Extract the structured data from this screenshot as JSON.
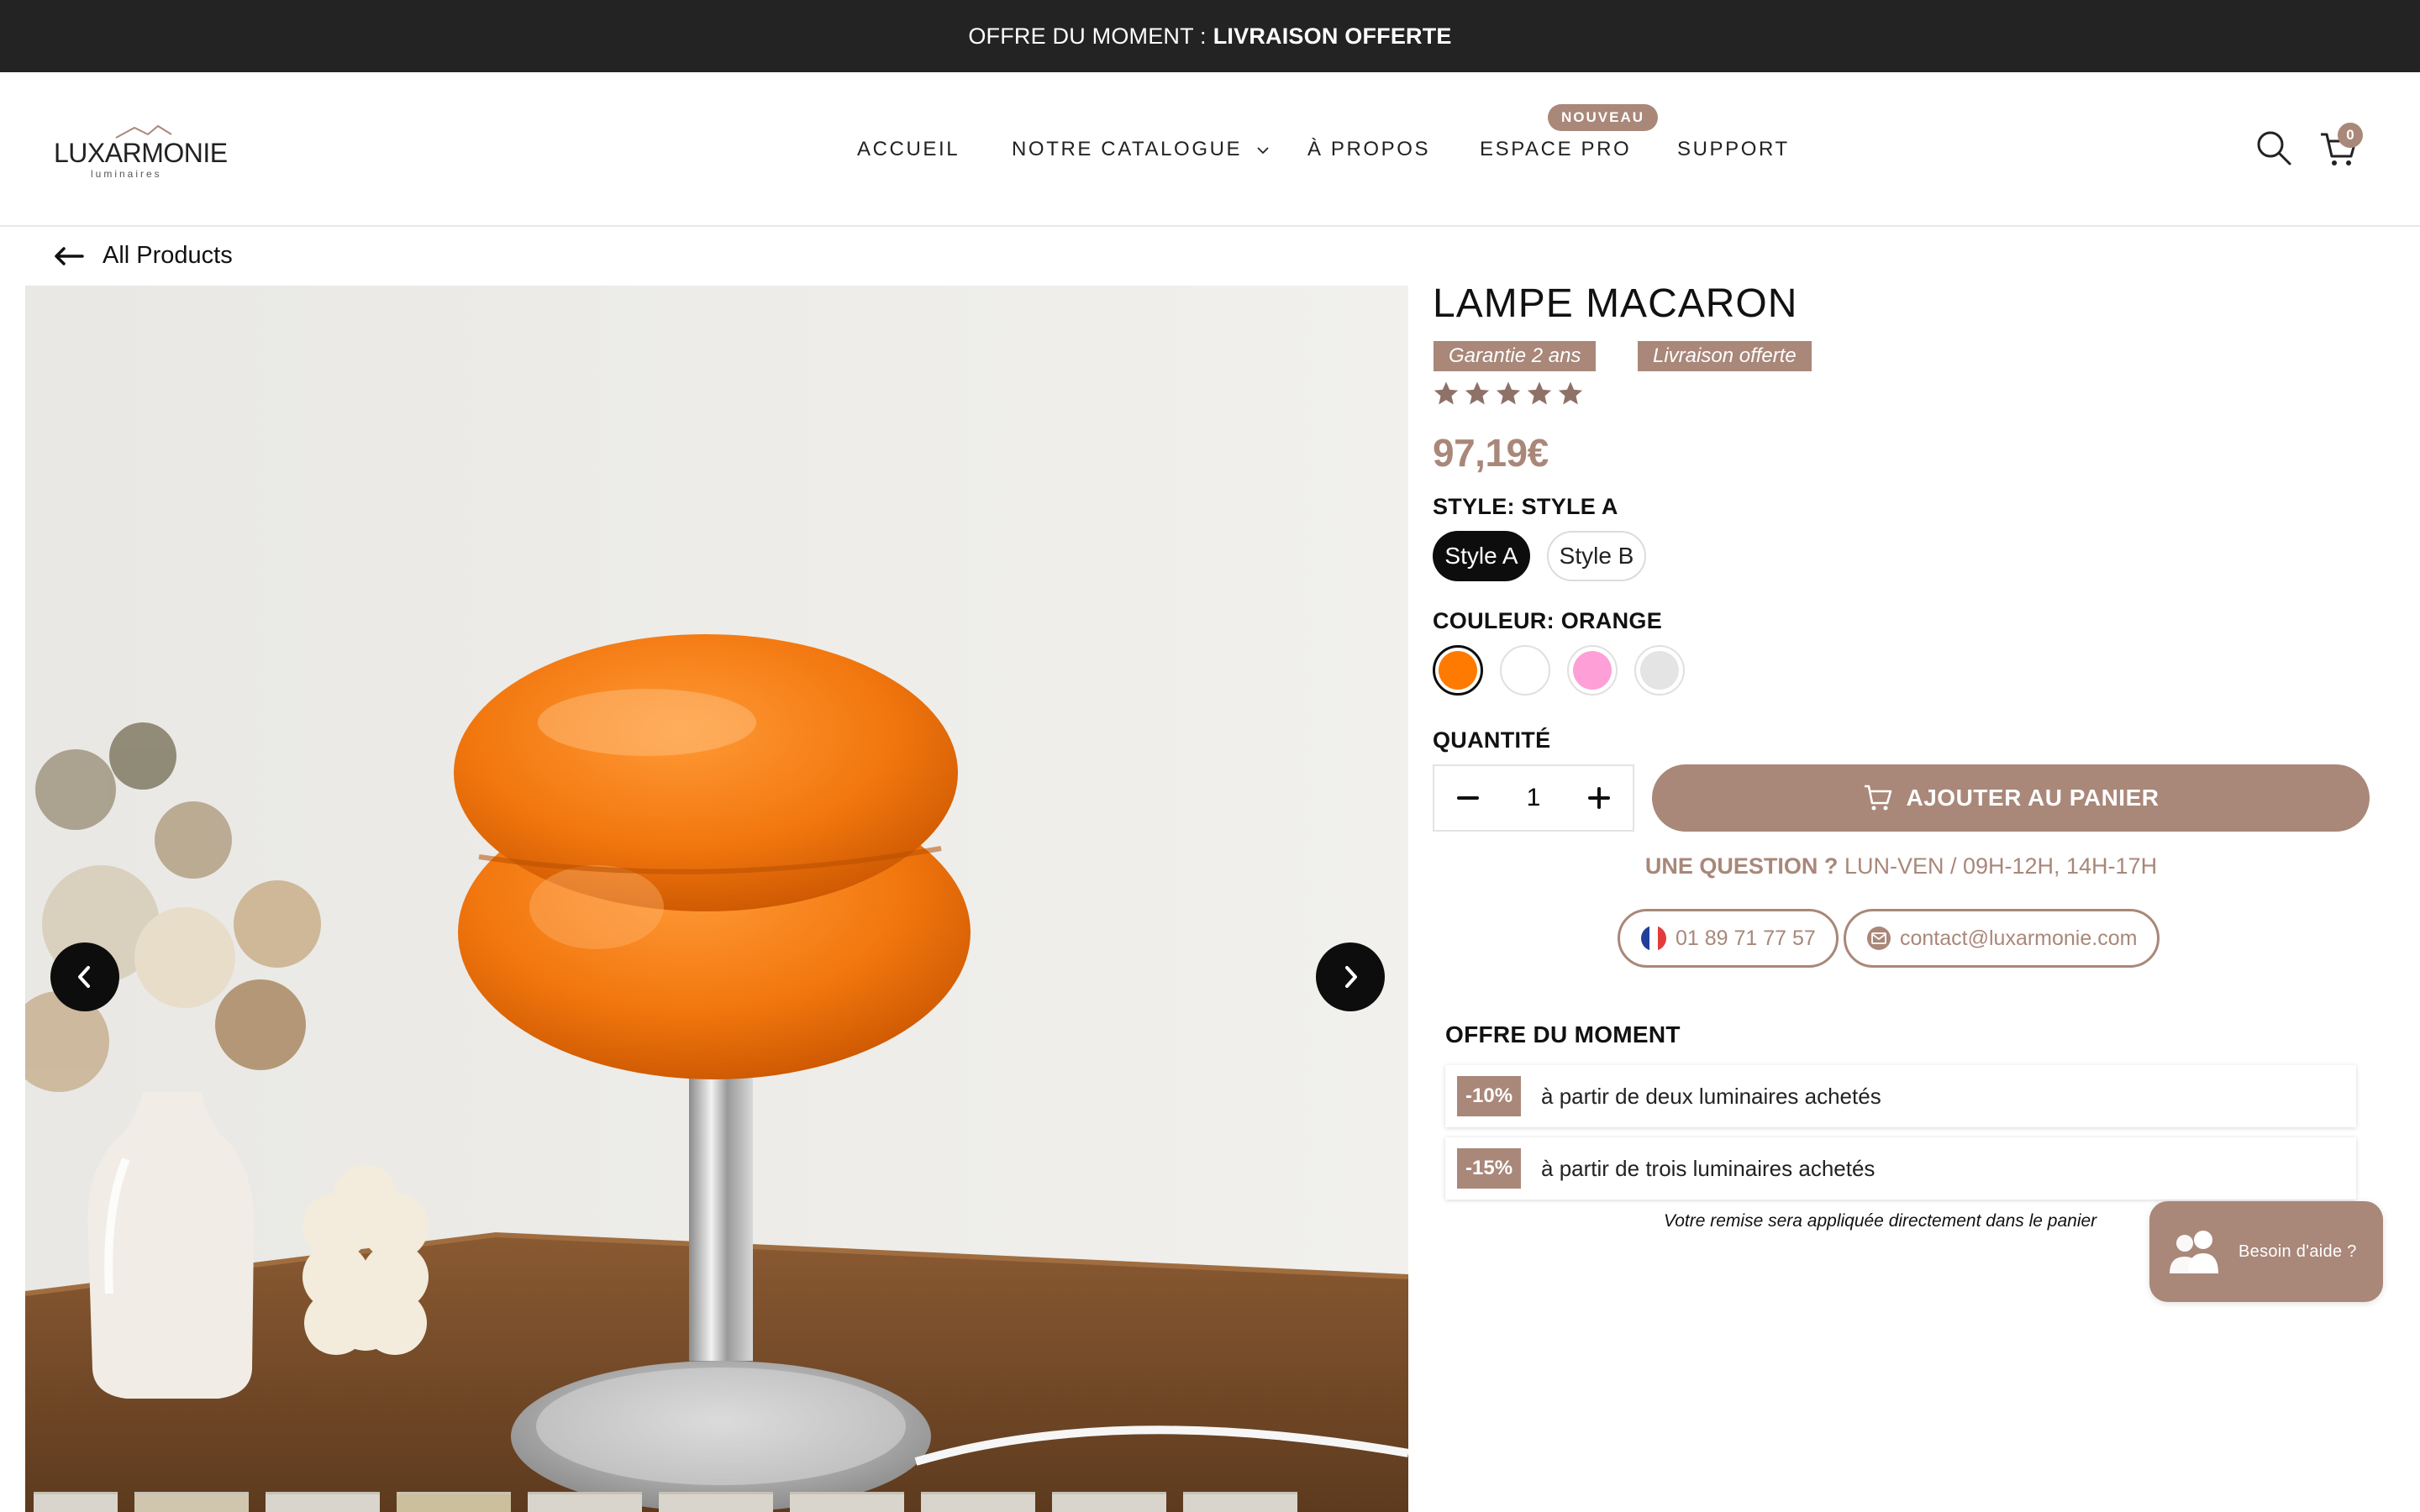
{
  "announcement": {
    "prefix": "OFFRE DU MOMENT :",
    "highlight": "LIVRAISON OFFERTE"
  },
  "logo": {
    "name": "LUXARMONIE",
    "tagline": "luminaires"
  },
  "nav": {
    "items": [
      {
        "label": "ACCUEIL"
      },
      {
        "label": "NOTRE CATALOGUE"
      },
      {
        "label": "À PROPOS"
      },
      {
        "label": "ESPACE PRO",
        "badge": "NOUVEAU"
      },
      {
        "label": "SUPPORT"
      }
    ],
    "cart_count": "0",
    "icons": [
      "search-icon",
      "cart-icon"
    ]
  },
  "back": {
    "label": "All Products"
  },
  "product": {
    "title": "LAMPE MACARON",
    "tags": [
      "Garantie 2 ans",
      "Livraison offerte"
    ],
    "rating": 5,
    "price": "97,19€",
    "style_label": "STYLE: STYLE A",
    "styles": [
      {
        "label": "Style A",
        "selected": true
      },
      {
        "label": "Style B",
        "selected": false
      }
    ],
    "color_label": "COULEUR: ORANGE",
    "colors": [
      {
        "name": "orange",
        "hex": "#ff7a00",
        "selected": true
      },
      {
        "name": "blanc",
        "hex": "#ffffff",
        "selected": false
      },
      {
        "name": "rose",
        "hex": "#ff9fd8",
        "selected": false
      },
      {
        "name": "gris",
        "hex": "#e4e4e4",
        "selected": false
      }
    ],
    "quantity_label": "QUANTITÉ",
    "quantity": "1",
    "add_to_cart": "AJOUTER AU PANIER"
  },
  "contact": {
    "question": "UNE QUESTION ?",
    "hours": "LUN-VEN / 09H-12H, 14H-17H",
    "phone": "01 89 71 77 57",
    "email": "contact@luxarmonie.com"
  },
  "offer": {
    "title": "OFFRE DU MOMENT",
    "rows": [
      {
        "badge": "-10%",
        "text": "à partir de deux luminaires achetés"
      },
      {
        "badge": "-15%",
        "text": "à partir de trois luminaires achetés"
      }
    ],
    "note": "Votre remise sera appliquée directement dans le panier"
  },
  "help": {
    "label": "Besoin d'aide ?"
  },
  "colors": {
    "accent": "#a98779",
    "announcement_bg": "#232323",
    "dark": "#0d0d0d"
  }
}
